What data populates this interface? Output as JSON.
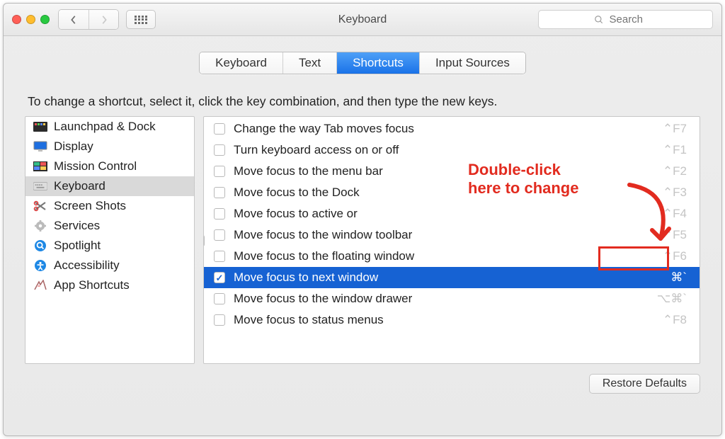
{
  "window": {
    "title": "Keyboard"
  },
  "search": {
    "placeholder": "Search"
  },
  "tabs": [
    {
      "label": "Keyboard",
      "active": false
    },
    {
      "label": "Text",
      "active": false
    },
    {
      "label": "Shortcuts",
      "active": true
    },
    {
      "label": "Input Sources",
      "active": false
    }
  ],
  "instruction": "To change a shortcut, select it, click the key combination, and then type the new keys.",
  "categories": [
    {
      "label": "Launchpad & Dock",
      "icon": "launchpad",
      "selected": false
    },
    {
      "label": "Display",
      "icon": "display",
      "selected": false
    },
    {
      "label": "Mission Control",
      "icon": "mission",
      "selected": false
    },
    {
      "label": "Keyboard",
      "icon": "keyboard",
      "selected": true
    },
    {
      "label": "Screen Shots",
      "icon": "scissors",
      "selected": false
    },
    {
      "label": "Services",
      "icon": "gear",
      "selected": false
    },
    {
      "label": "Spotlight",
      "icon": "spotlight",
      "selected": false
    },
    {
      "label": "Accessibility",
      "icon": "accessibility",
      "selected": false
    },
    {
      "label": "App Shortcuts",
      "icon": "apps",
      "selected": false
    }
  ],
  "shortcuts": [
    {
      "label": "Change the way Tab moves focus",
      "key": "⌃F7",
      "checked": false,
      "selected": false,
      "dim": true
    },
    {
      "label": "Turn keyboard access on or off",
      "key": "⌃F1",
      "checked": false,
      "selected": false,
      "dim": true
    },
    {
      "label": "Move focus to the menu bar",
      "key": "⌃F2",
      "checked": false,
      "selected": false,
      "dim": true
    },
    {
      "label": "Move focus to the Dock",
      "key": "⌃F3",
      "checked": false,
      "selected": false,
      "dim": true
    },
    {
      "label": "Move focus to active or",
      "key": "⌃F4",
      "checked": false,
      "selected": false,
      "dim": true
    },
    {
      "label": "Move focus to the window toolbar",
      "key": "⌃F5",
      "checked": false,
      "selected": false,
      "dim": true
    },
    {
      "label": "Move focus to the floating window",
      "key": "⌃F6",
      "checked": false,
      "selected": false,
      "dim": true
    },
    {
      "label": "Move focus to next window",
      "key": "⌘`",
      "checked": true,
      "selected": true,
      "dim": false
    },
    {
      "label": "Move focus to the window drawer",
      "key": "⌥⌘`",
      "checked": false,
      "selected": false,
      "dim": true
    },
    {
      "label": "Move focus to status menus",
      "key": "⌃F8",
      "checked": false,
      "selected": false,
      "dim": true
    }
  ],
  "footer": {
    "restore": "Restore Defaults"
  },
  "annotation": {
    "line1": "Double-click",
    "line2": "here to change"
  },
  "colors": {
    "accent": "#1662d3",
    "annotation": "#e22b1f"
  }
}
